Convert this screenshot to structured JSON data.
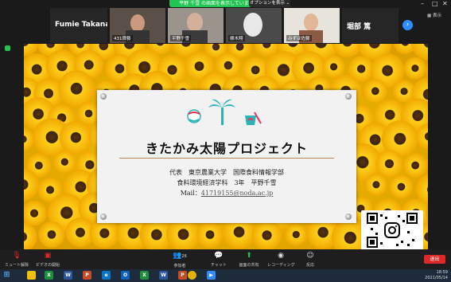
{
  "share_banner": {
    "status_text": "平野 千雪 の画面を表示しています",
    "view_options_label": "オプションを表示 ⌄"
  },
  "gallery": {
    "presenter_name": "Fumie Takanashi",
    "participants": [
      {
        "name": "431齊藤"
      },
      {
        "name": "平野千雪"
      },
      {
        "name": "柳木翔"
      },
      {
        "name": "みずほ佐藤"
      },
      {
        "name": "堀部 篤"
      }
    ],
    "display_label": "表示"
  },
  "shield_label": "",
  "slide": {
    "title": "きたかみ太陽プロジェクト",
    "line1": "代表　東京農業大学　国際食料情報学部",
    "line2": "食料環境経済学科　3年　平野千雪",
    "mail_label": "Mail：",
    "mail": "41719155@noda.ac.jp"
  },
  "toolbar": {
    "mute": "ミュート解除",
    "video": "ビデオの開始",
    "participants": "参加者",
    "participants_count": "26",
    "chat": "チャット",
    "share": "画面の共有",
    "record": "レコーディング",
    "reactions": "反応",
    "end": "退出"
  },
  "taskbar": {
    "time": "18:59",
    "date": "2021/05/14"
  },
  "colors": {
    "share_green": "#23c552",
    "end_red": "#e02828",
    "accent_blue": "#2d8cff",
    "title_rule": "#b3875a"
  }
}
